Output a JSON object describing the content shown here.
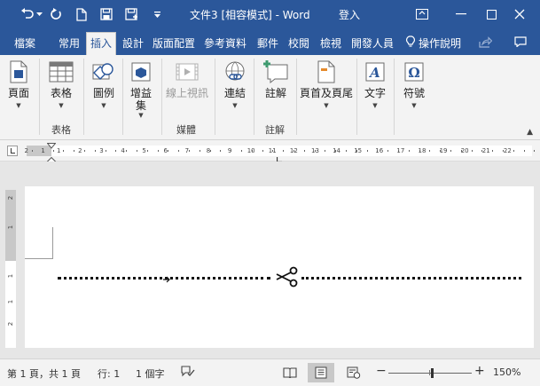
{
  "window": {
    "title": "文件3 [相容模式] - Word",
    "login": "登入",
    "bg_color": "#2b579a"
  },
  "quick_access": {
    "icons": [
      "undo-icon",
      "redo-icon",
      "new-document-icon",
      "save-icon",
      "save-as-icon",
      "customize-icon"
    ]
  },
  "tabs": [
    {
      "label": "檔案"
    },
    {
      "label": "常用"
    },
    {
      "label": "插入",
      "active": true
    },
    {
      "label": "設計"
    },
    {
      "label": "版面配置"
    },
    {
      "label": "參考資料"
    },
    {
      "label": "郵件"
    },
    {
      "label": "校閱"
    },
    {
      "label": "檢視"
    },
    {
      "label": "開發人員"
    }
  ],
  "tell_me": "操作說明",
  "ribbon": {
    "buttons": [
      {
        "label": "頁面",
        "icon": "pages-icon"
      },
      {
        "label": "表格",
        "icon": "table-icon"
      },
      {
        "label": "圖例",
        "icon": "illustrations-icon"
      },
      {
        "label": "增益",
        "label2": "集",
        "icon": "addins-icon"
      },
      {
        "label": "線上視訊",
        "icon": "online-video-icon",
        "disabled": true
      },
      {
        "label": "連結",
        "icon": "links-icon"
      },
      {
        "label": "註解",
        "icon": "comment-icon"
      },
      {
        "label": "頁首及頁尾",
        "icon": "header-footer-icon"
      },
      {
        "label": "文字",
        "icon": "text-icon"
      },
      {
        "label": "符號",
        "icon": "symbols-icon"
      }
    ],
    "groups": [
      {
        "label": "表格"
      },
      {
        "label": "媒體"
      },
      {
        "label": "註解"
      }
    ]
  },
  "ruler": {
    "numbers": [
      "2",
      "1",
      "1",
      "2",
      "3",
      "4",
      "5",
      "6",
      "7",
      "8",
      "9",
      "10",
      "11",
      "12",
      "13",
      "14",
      "15",
      "16",
      "17",
      "18",
      "19",
      "20",
      "21",
      "22"
    ],
    "vertical_numbers": [
      "2",
      "1",
      "1",
      "1",
      "2"
    ]
  },
  "statusbar": {
    "page": "第 1 頁，共 1 頁",
    "line": "行: 1",
    "words": "1 個字",
    "zoom_minus": "−",
    "zoom_plus": "+",
    "zoom": "150%"
  }
}
